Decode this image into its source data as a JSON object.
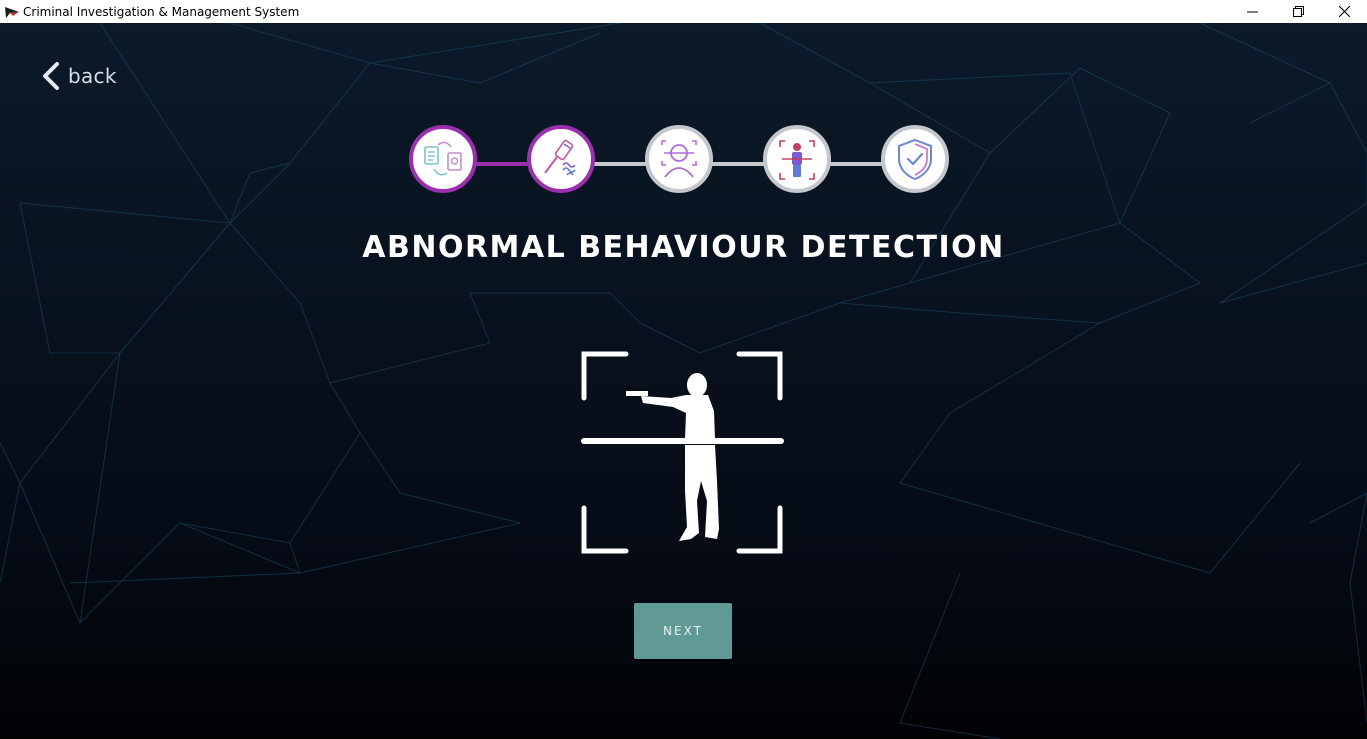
{
  "window": {
    "title": "Criminal Investigation & Management System",
    "icon": "app-logo-icon",
    "controls": [
      "minimize-icon",
      "restore-icon",
      "close-icon"
    ]
  },
  "nav": {
    "back_label": "back",
    "back_icon": "chevron-left-icon"
  },
  "stepper": {
    "active_color": "#9b2fae",
    "inactive_color": "#c4c8cc",
    "steps": [
      {
        "icon": "document-compare-icon",
        "state": "completed"
      },
      {
        "icon": "fingerprint-tool-icon",
        "state": "current"
      },
      {
        "icon": "face-scan-icon",
        "state": "pending"
      },
      {
        "icon": "body-scan-icon",
        "state": "pending"
      },
      {
        "icon": "shield-check-icon",
        "state": "pending"
      }
    ]
  },
  "page": {
    "heading": "ABNORMAL BEHAVIOUR DETECTION",
    "illustration": "gunman-scan-icon"
  },
  "actions": {
    "next_label": "NEXT",
    "next_color": "#5f9a95"
  }
}
